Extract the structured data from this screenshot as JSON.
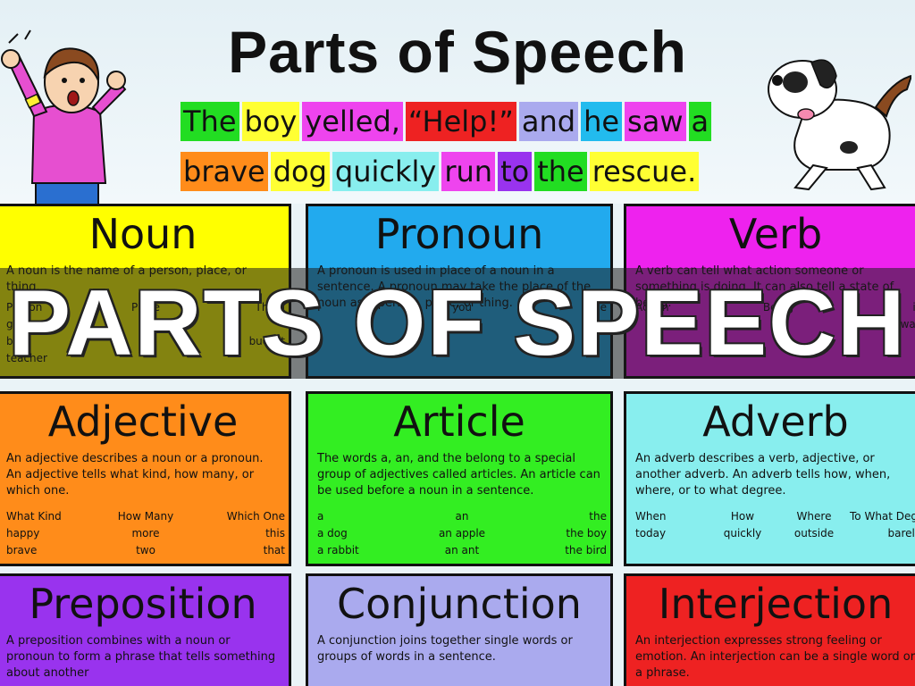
{
  "poster": {
    "title": "Parts of Speech",
    "sentence_line1": [
      {
        "word": "The",
        "color": "#22dd22"
      },
      {
        "word": "boy",
        "color": "#ffff33"
      },
      {
        "word": "yelled,",
        "color": "#ee44ee"
      },
      {
        "word": "“Help!”",
        "color": "#ee2222"
      },
      {
        "word": "and",
        "color": "#aaaaee"
      },
      {
        "word": "he",
        "color": "#22bbee"
      },
      {
        "word": "saw",
        "color": "#ee44ee"
      },
      {
        "word": "a",
        "color": "#22dd22"
      }
    ],
    "sentence_line2": [
      {
        "word": "brave",
        "color": "#ff8c1a"
      },
      {
        "word": "dog",
        "color": "#ffff33"
      },
      {
        "word": "quickly",
        "color": "#88eeee"
      },
      {
        "word": "run",
        "color": "#ee44ee"
      },
      {
        "word": "to",
        "color": "#9933ee"
      },
      {
        "word": "the",
        "color": "#22dd22"
      },
      {
        "word": "rescue.",
        "color": "#ffff33"
      }
    ]
  },
  "cards": [
    {
      "title": "Noun",
      "color": "#ffff00",
      "desc": "A noun is the name of a person, place, or thing.",
      "cols": [
        [
          "Person",
          "girl",
          "boy",
          "teacher"
        ],
        [
          "Place"
        ],
        [
          "Thing",
          "",
          "bucket",
          ""
        ]
      ]
    },
    {
      "title": "Pronoun",
      "color": "#22aaee",
      "desc": "A pronoun is used in place of a noun in a sentence. A pronoun may take the place of the noun as a person, place, or thing.",
      "cols": [
        [
          "I"
        ],
        [
          "you"
        ],
        [
          "she",
          "they"
        ]
      ]
    },
    {
      "title": "Verb",
      "color": "#ee22ee",
      "desc": "A verb can tell what action someone or something is doing. It can also tell a state of being.",
      "cols": [
        [
          "Action"
        ],
        [
          "Being"
        ],
        [
          "is",
          "was"
        ]
      ]
    },
    {
      "title": "Adjective",
      "color": "#ff8c1a",
      "desc": "An adjective describes a noun or a pronoun. An adjective tells what kind, how many, or which one.",
      "cols": [
        [
          "What Kind",
          "happy",
          "brave"
        ],
        [
          "How Many",
          "more",
          "two"
        ],
        [
          "Which One",
          "this",
          "that"
        ]
      ]
    },
    {
      "title": "Article",
      "color": "#33ee22",
      "desc": "The words a, an, and the belong to a special group of adjectives called articles. An article can be used before a noun in a sentence.",
      "cols": [
        [
          "a",
          "a dog",
          "a rabbit"
        ],
        [
          "an",
          "an apple",
          "an ant"
        ],
        [
          "the",
          "the boy",
          "the bird"
        ]
      ]
    },
    {
      "title": "Adverb",
      "color": "#88eeee",
      "desc": "An adverb describes a verb, adjective, or another adverb. An adverb tells how, when, where, or to what degree.",
      "cols": [
        [
          "When",
          "today"
        ],
        [
          "How",
          "quickly"
        ],
        [
          "Where",
          "outside"
        ],
        [
          "To What Degree",
          "barely"
        ]
      ]
    },
    {
      "title": "Preposition",
      "color": "#9933ee",
      "desc": "A preposition combines with a noun or pronoun to form a phrase that tells something about another",
      "cols": []
    },
    {
      "title": "Conjunction",
      "color": "#aaaaee",
      "desc": "A conjunction joins together single words or groups of words in a sentence.",
      "cols": []
    },
    {
      "title": "Interjection",
      "color": "#ee2222",
      "desc": "An interjection expresses strong feeling or emotion. An interjection can be a single word or a phrase.",
      "cols": []
    }
  ],
  "banner": {
    "text": "PARTS OF SPEECH"
  }
}
